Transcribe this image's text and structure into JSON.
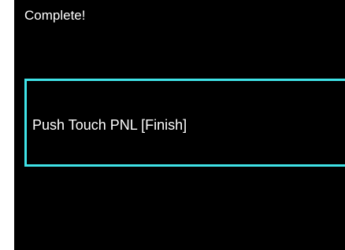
{
  "screen": {
    "title": "Complete!",
    "message": "Push Touch PNL [Finish]"
  },
  "colors": {
    "background": "#000000",
    "text": "#ffffff",
    "accent_border": "#3fe3e8"
  }
}
